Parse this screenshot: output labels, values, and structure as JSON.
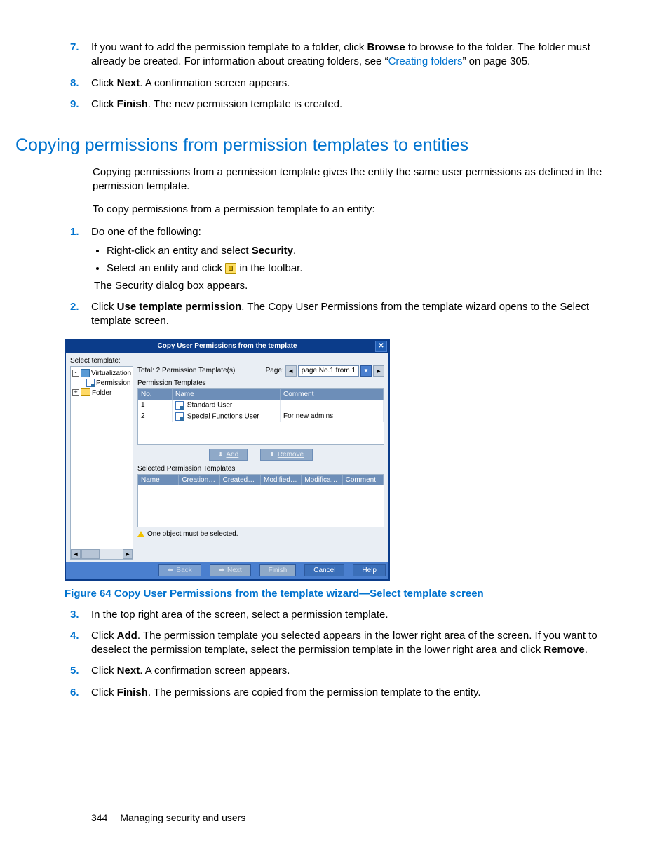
{
  "topSteps": [
    {
      "num": "7.",
      "html": [
        "If you want to add the permission template to a folder, click ",
        [
          "b",
          "Browse"
        ],
        " to browse to the folder. The folder must already be created. For information about creating folders, see “",
        [
          "link",
          "Creating folders"
        ],
        "” on page 305."
      ]
    },
    {
      "num": "8.",
      "html": [
        "Click ",
        [
          "b",
          "Next"
        ],
        ". A confirmation screen appears."
      ]
    },
    {
      "num": "9.",
      "html": [
        "Click ",
        [
          "b",
          "Finish"
        ],
        ". The new permission template is created."
      ]
    }
  ],
  "section": {
    "title": "Copying permissions from permission templates to entities",
    "p1": "Copying permissions from a permission template gives the entity the same user permissions as defined in the permission template.",
    "p2": "To copy permissions from a permission template to an entity:"
  },
  "procSteps": [
    {
      "num": "1.",
      "text": "Do one of the following:",
      "subs": [
        {
          "html": [
            "Right-click an entity and select ",
            [
              "b",
              "Security"
            ],
            "."
          ]
        },
        {
          "html": [
            "Select an entity and click ",
            [
              "icon",
              "lock"
            ],
            " in the toolbar."
          ],
          "after": "The Security dialog box appears."
        }
      ]
    },
    {
      "num": "2.",
      "html": [
        "Click ",
        [
          "b",
          "Use template permission"
        ],
        ". The Copy User Permissions from the template wizard opens to the Select template screen."
      ]
    }
  ],
  "wizard": {
    "title": "Copy User Permissions from the template",
    "selectLabel": "Select template:",
    "tree": [
      {
        "exp": "-",
        "icon": "doc",
        "label": "Virtualization"
      },
      {
        "exp": "",
        "icon": "perm",
        "label": "Permission",
        "indent": true
      },
      {
        "exp": "+",
        "icon": "folder",
        "label": "Folder"
      }
    ],
    "total": "Total: 2 Permission Template(s)",
    "pageLabel": "Page:",
    "pageSel": "page No.1 from 1",
    "tableLabel": "Permission Templates",
    "table1": {
      "headers": [
        "No.",
        "Name",
        "Comment"
      ],
      "rows": [
        {
          "no": "1",
          "name": "Standard User",
          "comment": ""
        },
        {
          "no": "2",
          "name": "Special Functions User",
          "comment": "For new admins"
        }
      ]
    },
    "addBtn": "Add",
    "removeBtn": "Remove",
    "selLabel": "Selected Permission Templates",
    "table2Headers": [
      "Name",
      "Creation…",
      "Created…",
      "Modified…",
      "Modifica…",
      "Comment"
    ],
    "warn": "One object must be selected.",
    "footer": {
      "back": "Back",
      "next": "Next",
      "finish": "Finish",
      "cancel": "Cancel",
      "help": "Help"
    }
  },
  "figCaption": "Figure 64 Copy User Permissions from the template wizard—Select template screen",
  "afterSteps": [
    {
      "num": "3.",
      "text": "In the top right area of the screen, select a permission template."
    },
    {
      "num": "4.",
      "html": [
        "Click ",
        [
          "b",
          "Add"
        ],
        ". The permission template you selected appears in the lower right area of the screen. If you want to deselect the permission template, select the permission template in the lower right area and click ",
        [
          "b",
          "Remove"
        ],
        "."
      ]
    },
    {
      "num": "5.",
      "html": [
        "Click ",
        [
          "b",
          "Next"
        ],
        ". A confirmation screen appears."
      ]
    },
    {
      "num": "6.",
      "html": [
        "Click ",
        [
          "b",
          "Finish"
        ],
        ". The permissions are copied from the permission template to the entity."
      ]
    }
  ],
  "footer": {
    "page": "344",
    "title": "Managing security and users"
  }
}
